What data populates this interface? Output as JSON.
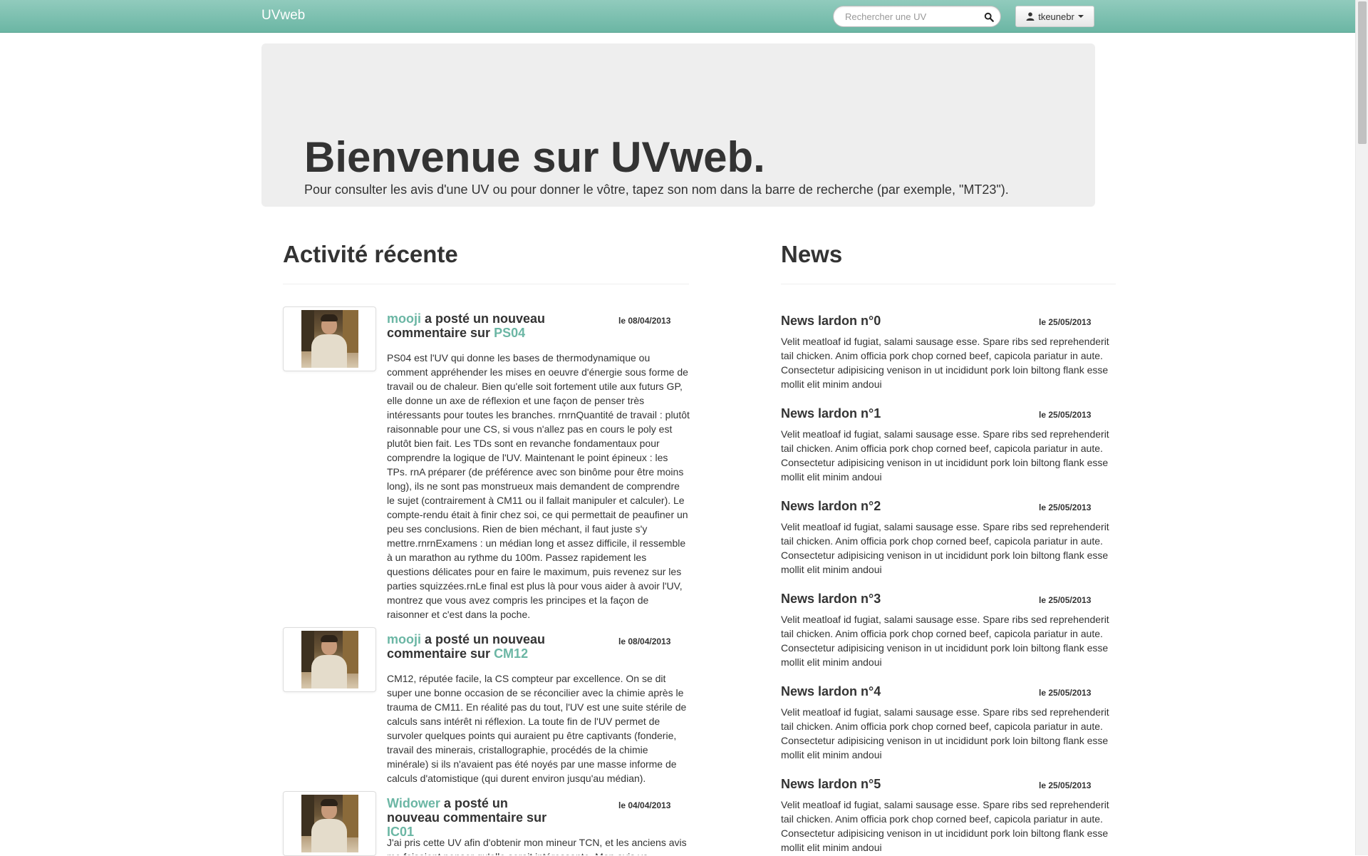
{
  "navbar": {
    "brand": "UVweb",
    "search_placeholder": "Rechercher une UV",
    "user_label": "tkeunebr"
  },
  "hero": {
    "title": "Bienvenue sur UVweb.",
    "subtitle": "Pour consulter les avis d'une UV ou pour donner le vôtre, tapez son nom dans la barre de recherche (par exemple, \"MT23\")."
  },
  "activity": {
    "title": "Activité récente",
    "items": [
      {
        "user": "mooji",
        "action": " a posté un nouveau commentaire sur ",
        "uv": "PS04",
        "date": "le 08/04/2013",
        "text": "PS04 est l'UV qui donne les bases de thermodynamique ou comment appréhender les mises en oeuvre d'énergie sous forme de travail ou de chaleur. Bien qu'elle soit fortement utile aux futurs GP, elle donne un axe de réflexion et une façon de penser très intéressants pour toutes les branches. rnrnQuantité de travail : plutôt raisonnable pour une CS, si vous n'allez pas en cours le poly est plutôt bien fait. Les TDs sont en revanche fondamentaux pour comprendre la logique de l'UV. Maintenant le point épineux : les TPs. rnA préparer (de préférence avec son binôme pour être moins long), ils ne sont pas monstrueux mais demandent de comprendre le sujet (contrairement à CM11 ou il fallait manipuler et calculer). Le compte-rendu était à finir chez soi, ce qui permettait de peaufiner un peu ses conclusions. Rien de bien méchant, il faut juste s'y mettre.rnrnExamens : un médian long et assez difficile, il ressemble à un marathon au rythme du 100m. Passez rapidement les questions délicates pour en faire le maximum, puis revenez sur les parties squizzées.rnLe final est plus là pour vous aider à avoir l'UV, montrez que vous avez compris les principes et la façon de raisonner et c'est dans la poche."
      },
      {
        "user": "mooji",
        "action": " a posté un nouveau commentaire sur ",
        "uv": "CM12",
        "date": "le 08/04/2013",
        "text": "CM12, réputée facile, la CS compteur par excellence. On se dit super une bonne occasion de se réconcilier avec la chimie après le trauma de CM11. En réalité pas du tout, l'UV est une suite stérile de calculs sans intérêt ni réflexion. La toute fin de l'UV permet de survoler quelques points qui auraient pu être captivants (fonderie, travail des minerais, cristallographie, procédés de la chimie minérale) si ils n'avaient pas été noyés par une masse informe de calculs d'atomistique (qui durent environ jusqu'au médian)."
      },
      {
        "user": "Widower",
        "action": " a posté un nouveau commentaire sur ",
        "uv": "IC01",
        "date": "le 04/04/2013",
        "text": "J'ai pris cette UV afin d'obtenir mon mineur TCN, et les anciens avis me faisaient penser qu'elle serait intéressante. Mon avis va"
      }
    ]
  },
  "news": {
    "title": "News",
    "items": [
      {
        "title": "News lardon n°0",
        "date": "le 25/05/2013",
        "text": "Velit meatloaf id fugiat, salami sausage esse. Spare ribs sed reprehenderit tail chicken. Anim officia pork chop corned beef, capicola pariatur in aute. Consectetur adipisicing venison in ut incididunt pork loin biltong flank esse mollit elit minim andoui"
      },
      {
        "title": "News lardon n°1",
        "date": "le 25/05/2013",
        "text": "Velit meatloaf id fugiat, salami sausage esse. Spare ribs sed reprehenderit tail chicken. Anim officia pork chop corned beef, capicola pariatur in aute. Consectetur adipisicing venison in ut incididunt pork loin biltong flank esse mollit elit minim andoui"
      },
      {
        "title": "News lardon n°2",
        "date": "le 25/05/2013",
        "text": "Velit meatloaf id fugiat, salami sausage esse. Spare ribs sed reprehenderit tail chicken. Anim officia pork chop corned beef, capicola pariatur in aute. Consectetur adipisicing venison in ut incididunt pork loin biltong flank esse mollit elit minim andoui"
      },
      {
        "title": "News lardon n°3",
        "date": "le 25/05/2013",
        "text": "Velit meatloaf id fugiat, salami sausage esse. Spare ribs sed reprehenderit tail chicken. Anim officia pork chop corned beef, capicola pariatur in aute. Consectetur adipisicing venison in ut incididunt pork loin biltong flank esse mollit elit minim andoui"
      },
      {
        "title": "News lardon n°4",
        "date": "le 25/05/2013",
        "text": "Velit meatloaf id fugiat, salami sausage esse. Spare ribs sed reprehenderit tail chicken. Anim officia pork chop corned beef, capicola pariatur in aute. Consectetur adipisicing venison in ut incididunt pork loin biltong flank esse mollit elit minim andoui"
      },
      {
        "title": "News lardon n°5",
        "date": "le 25/05/2013",
        "text": "Velit meatloaf id fugiat, salami sausage esse. Spare ribs sed reprehenderit tail chicken. Anim officia pork chop corned beef, capicola pariatur in aute. Consectetur adipisicing venison in ut incididunt pork loin biltong flank esse mollit elit minim andoui"
      }
    ]
  },
  "colors": {
    "navbar": "#7fc1b1",
    "link": "#6bb6a4",
    "hero_bg": "#eeeeee"
  },
  "icons": {
    "search": "search-icon",
    "user": "user-icon",
    "dropdown": "caret-down-icon",
    "avatar": "avatar"
  }
}
